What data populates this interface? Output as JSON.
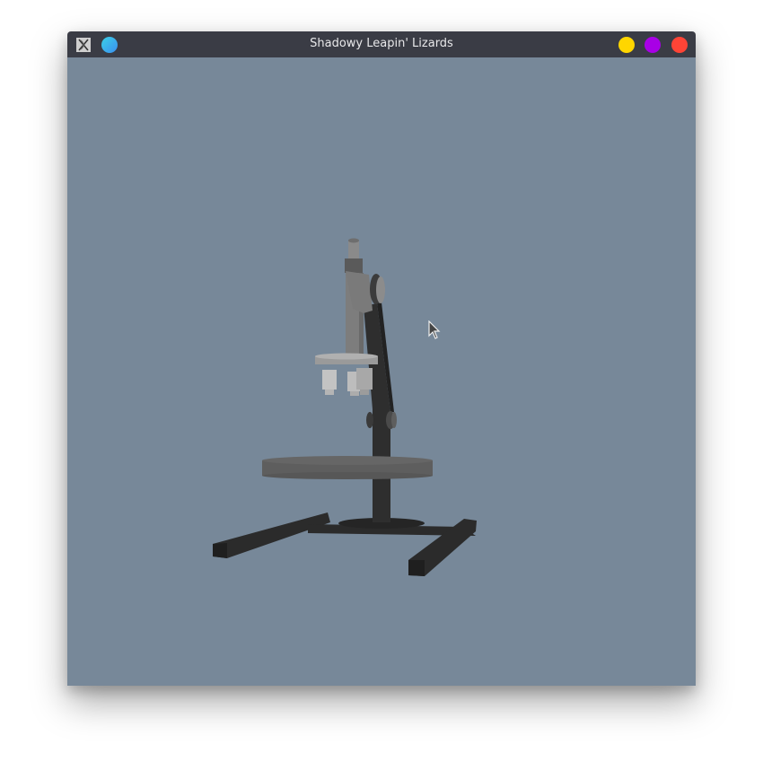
{
  "window": {
    "title": "Shadowy Leapin' Lizards"
  },
  "titlebar": {
    "app_icon": "x-window-icon",
    "menu_icon": "menu-orb-icon",
    "buttons": [
      {
        "name": "minimize",
        "color": "#ffd600"
      },
      {
        "name": "maximize",
        "color": "#a800e6"
      },
      {
        "name": "close",
        "color": "#ff4436"
      }
    ]
  },
  "viewport": {
    "background": "#778899",
    "object": "microscope-model"
  }
}
